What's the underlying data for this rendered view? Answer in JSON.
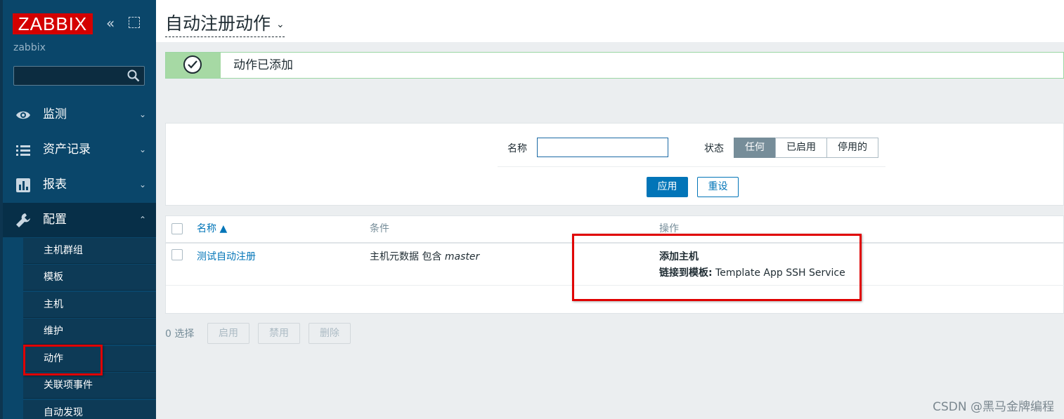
{
  "sidebar": {
    "logo": "ZABBIX",
    "collapse_glyph": "«",
    "server_name": "zabbix",
    "search_placeholder": "",
    "menu": [
      {
        "label": "监测",
        "icon": "eye-icon",
        "chevron": "⌄"
      },
      {
        "label": "资产记录",
        "icon": "list-icon",
        "chevron": "⌄"
      },
      {
        "label": "报表",
        "icon": "bar-chart-icon",
        "chevron": "⌄"
      },
      {
        "label": "配置",
        "icon": "wrench-icon",
        "chevron": "⌃"
      }
    ],
    "submenu": [
      "主机群组",
      "模板",
      "主机",
      "维护",
      "动作",
      "关联项事件",
      "自动发现"
    ],
    "active_submenu": "动作"
  },
  "header": {
    "title": "自动注册动作",
    "title_chevron": "⌄"
  },
  "message": {
    "text": "动作已添加",
    "icon": "check-circle-icon"
  },
  "filter": {
    "name_label": "名称",
    "name_value": "",
    "status_label": "状态",
    "status_options": [
      "任何",
      "已启用",
      "停用的"
    ],
    "status_selected": "任何",
    "apply_label": "应用",
    "reset_label": "重设"
  },
  "table": {
    "columns": [
      "名称 ▲",
      "条件",
      "操作"
    ],
    "rows": [
      {
        "name": "测试自动注册",
        "condition_prefix": "主机元数据 包含 ",
        "condition_value": "master",
        "op_line1": "添加主机",
        "op_line2_label": "链接到模板:",
        "op_line2_value": " Template App SSH Service"
      }
    ]
  },
  "bulk": {
    "selected_count": "0 选择",
    "enable_label": "启用",
    "disable_label": "禁用",
    "delete_label": "删除"
  },
  "watermark": "CSDN @黑马金牌编程",
  "colors": {
    "sidebar_bg": "#0a466a",
    "accent": "#0275b8",
    "logo_red": "#d40000",
    "success_green": "#a6d9a4",
    "highlight_red": "#e00000"
  }
}
